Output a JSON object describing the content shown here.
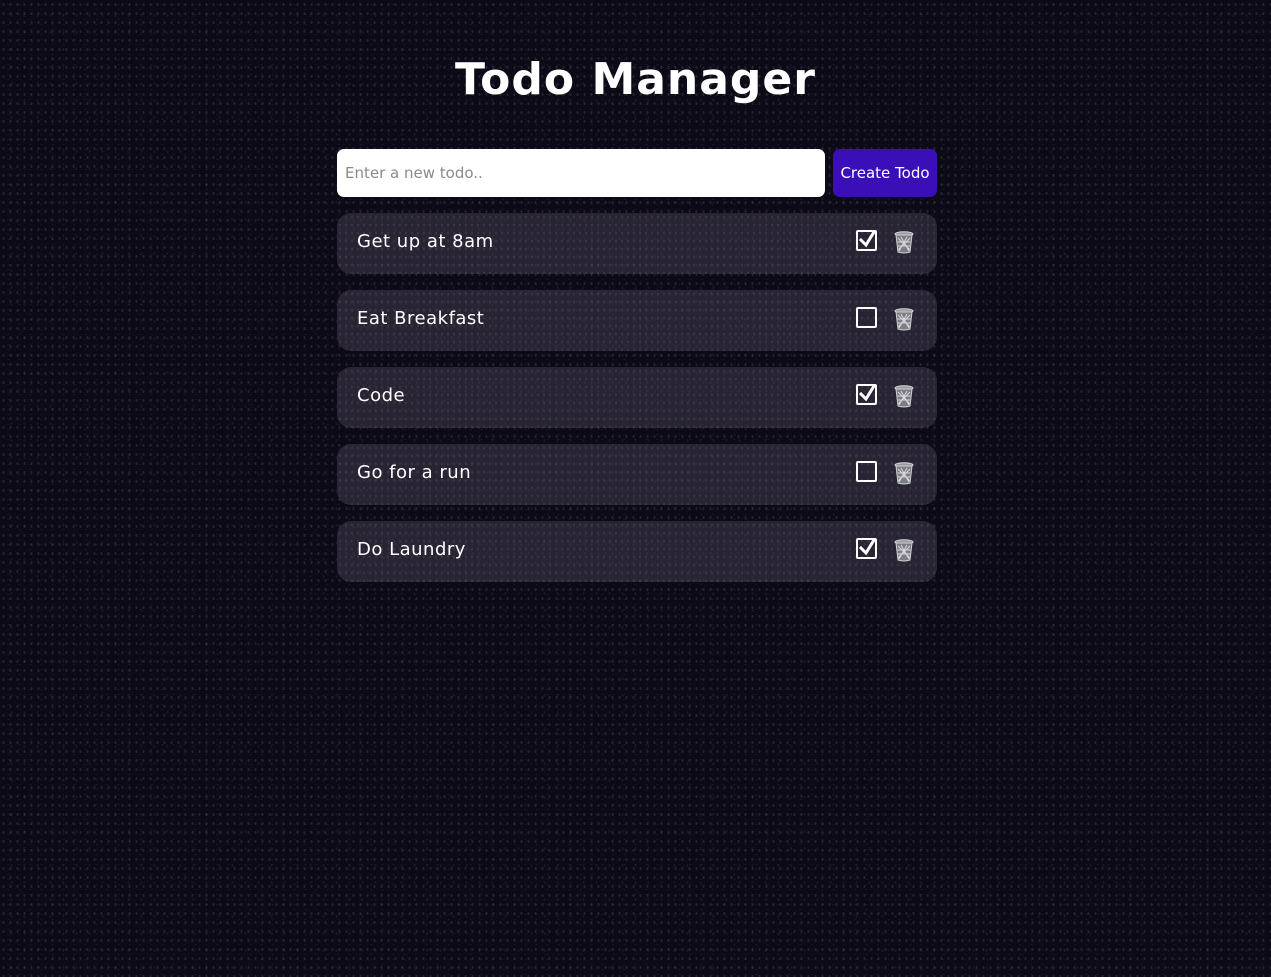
{
  "app": {
    "title": "Todo Manager"
  },
  "form": {
    "input_placeholder": "Enter a new todo..",
    "input_value": "",
    "create_label": "Create Todo"
  },
  "todos": [
    {
      "text": "Get up at 8am",
      "completed": true
    },
    {
      "text": "Eat Breakfast",
      "completed": false
    },
    {
      "text": "Code",
      "completed": true
    },
    {
      "text": "Go for a run",
      "completed": false
    },
    {
      "text": "Do Laundry",
      "completed": true
    }
  ],
  "icons": {
    "checkbox_checked": "check-icon",
    "delete": "trash-icon"
  },
  "colors": {
    "background": "#0d0a17",
    "accent_button": "#3a0fb8",
    "item_background": "#2b2733",
    "text": "#ffffff"
  }
}
